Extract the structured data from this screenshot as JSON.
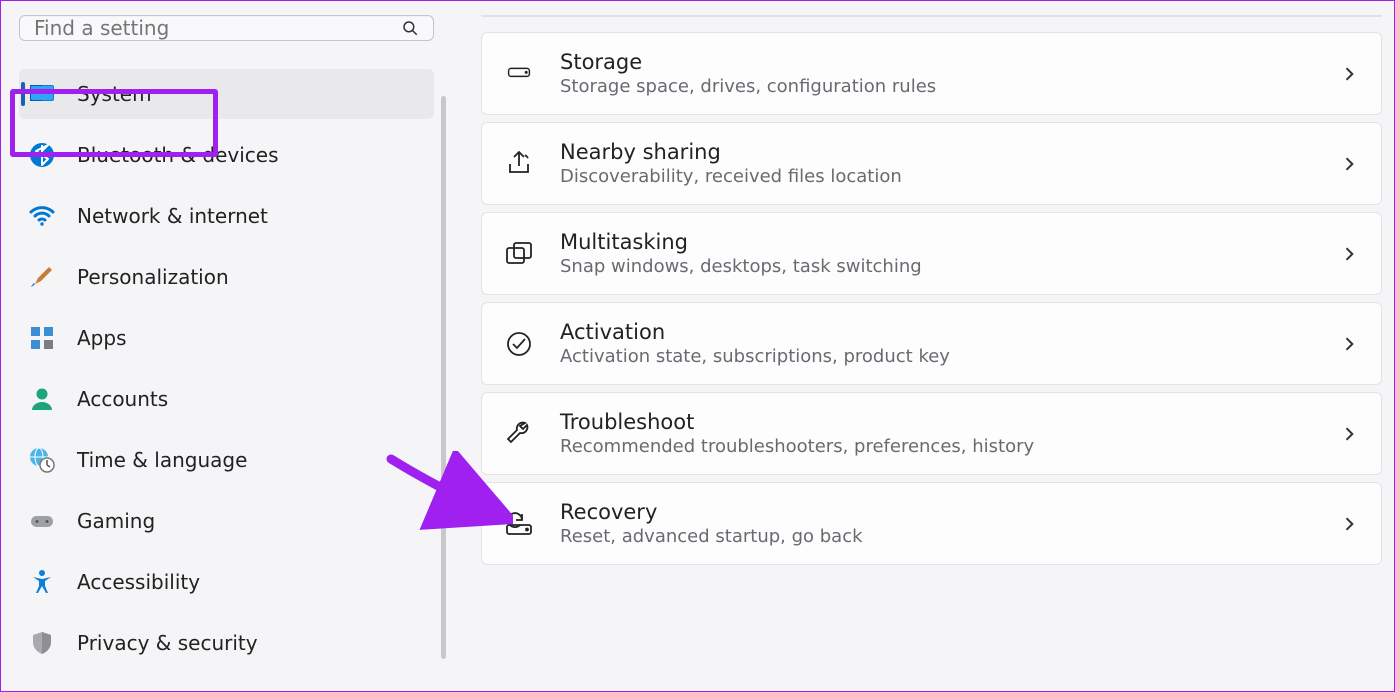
{
  "search": {
    "placeholder": "Find a setting"
  },
  "sidebar": {
    "items": [
      {
        "label": "System",
        "icon": "system",
        "selected": true
      },
      {
        "label": "Bluetooth & devices",
        "icon": "bluetooth"
      },
      {
        "label": "Network & internet",
        "icon": "wifi"
      },
      {
        "label": "Personalization",
        "icon": "brush"
      },
      {
        "label": "Apps",
        "icon": "apps"
      },
      {
        "label": "Accounts",
        "icon": "person"
      },
      {
        "label": "Time & language",
        "icon": "clock"
      },
      {
        "label": "Gaming",
        "icon": "gamepad"
      },
      {
        "label": "Accessibility",
        "icon": "access"
      },
      {
        "label": "Privacy & security",
        "icon": "shield"
      }
    ]
  },
  "main": {
    "cards": [
      {
        "title": "Storage",
        "sub": "Storage space, drives, configuration rules",
        "icon": "drive"
      },
      {
        "title": "Nearby sharing",
        "sub": "Discoverability, received files location",
        "icon": "share"
      },
      {
        "title": "Multitasking",
        "sub": "Snap windows, desktops, task switching",
        "icon": "multitask"
      },
      {
        "title": "Activation",
        "sub": "Activation state, subscriptions, product key",
        "icon": "check"
      },
      {
        "title": "Troubleshoot",
        "sub": "Recommended troubleshooters, preferences, history",
        "icon": "wrench"
      },
      {
        "title": "Recovery",
        "sub": "Reset, advanced startup, go back",
        "icon": "recovery"
      }
    ]
  }
}
